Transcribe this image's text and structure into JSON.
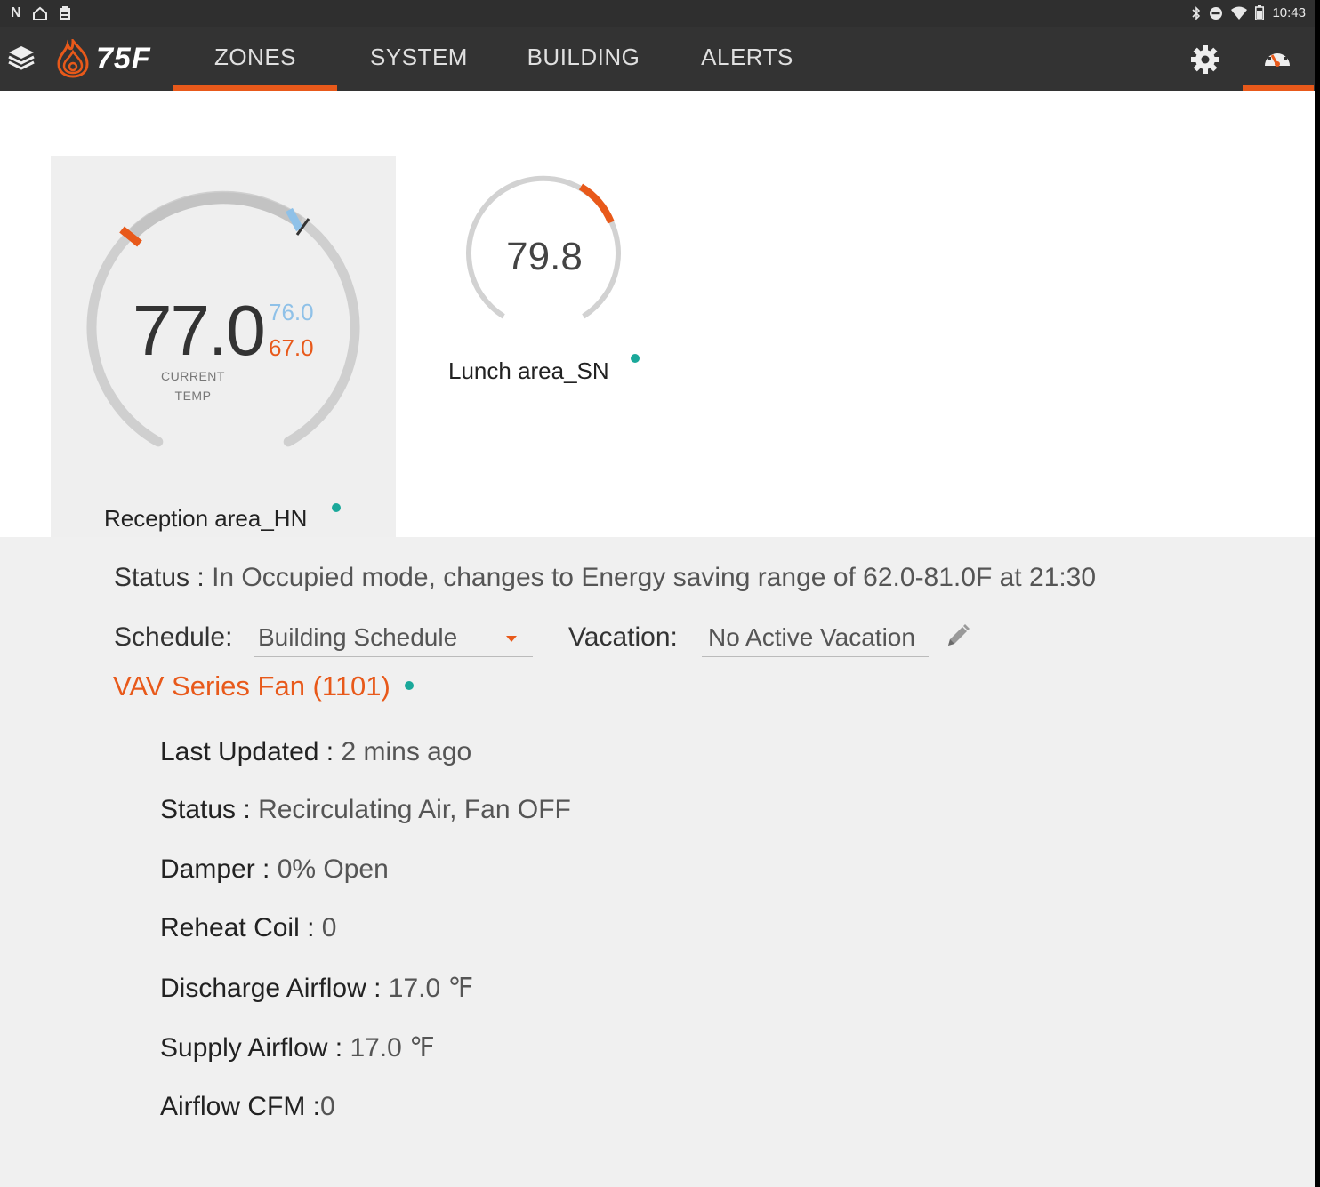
{
  "status_bar": {
    "time": "10:43",
    "left_icons": [
      "n-logo-icon",
      "home-icon",
      "clipboard-icon"
    ],
    "right_icons": [
      "bluetooth-icon",
      "dnd-icon",
      "wifi-icon",
      "battery-icon"
    ]
  },
  "nav": {
    "logo_text": "75F",
    "tabs": [
      {
        "label": "ZONES",
        "active": true
      },
      {
        "label": "SYSTEM",
        "active": false
      },
      {
        "label": "BUILDING",
        "active": false
      },
      {
        "label": "ALERTS",
        "active": false
      }
    ]
  },
  "zones": [
    {
      "name": "Reception area_HN",
      "current_temp": "77.0",
      "cool_setpoint": "76.0",
      "heat_setpoint": "67.0",
      "current_label_line1": "CURRENT",
      "current_label_line2": "TEMP",
      "online": true
    },
    {
      "name": "Lunch area_SN",
      "current_temp": "79.8",
      "online": true
    }
  ],
  "details": {
    "status_label": "Status :",
    "status_value": "In Occupied mode, changes to Energy saving range of 62.0-81.0F at 21:30",
    "schedule_label": "Schedule:",
    "schedule_value": "Building Schedule",
    "vacation_label": "Vacation:",
    "vacation_value": "No Active Vacation"
  },
  "equipment": {
    "title": "VAV Series Fan (1101)",
    "rows": [
      {
        "label": "Last Updated :",
        "value": "2 mins ago"
      },
      {
        "label": "Status :",
        "value": "Recirculating Air, Fan OFF"
      },
      {
        "label": "Damper :",
        "value": "0% Open"
      },
      {
        "label": "Reheat Coil :",
        "value": "0"
      },
      {
        "label": "Discharge Airflow :",
        "value": "17.0 ℉"
      },
      {
        "label": "Supply Airflow :",
        "value": "17.0 ℉"
      },
      {
        "label": "Airflow CFM :",
        "value": "0"
      }
    ]
  },
  "colors": {
    "accent": "#e8591a",
    "online": "#1aa89a",
    "cool": "#8fc1e8",
    "nav_bg": "#333333"
  }
}
